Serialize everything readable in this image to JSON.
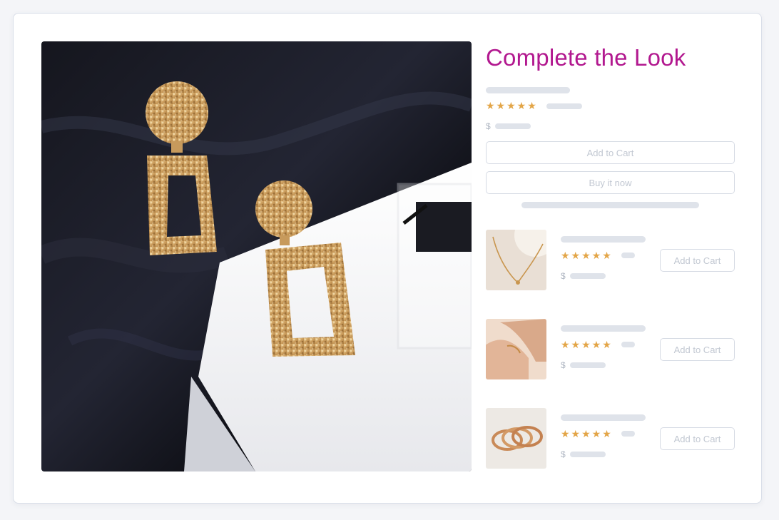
{
  "widget": {
    "title": "Complete the Look",
    "main_product": {
      "rating": "★★★★★",
      "currency": "$",
      "add_to_cart_label": "Add to Cart",
      "buy_now_label": "Buy it now"
    },
    "related_items": [
      {
        "image": "gold-chain-necklace",
        "rating": "★★★★★",
        "currency": "$",
        "add_to_cart_label": "Add to Cart"
      },
      {
        "image": "gold-bracelet-on-wrist",
        "rating": "★★★★★",
        "currency": "$",
        "add_to_cart_label": "Add to Cart"
      },
      {
        "image": "stacked-gold-rings",
        "rating": "★★★★★",
        "currency": "$",
        "add_to_cart_label": "Add to Cart"
      }
    ]
  },
  "colors": {
    "title": "#b2188f",
    "star": "#e3a547",
    "placeholder_bar": "#dfe3ea",
    "button_border": "#d6dbe4",
    "button_text": "#c2c8d2"
  }
}
